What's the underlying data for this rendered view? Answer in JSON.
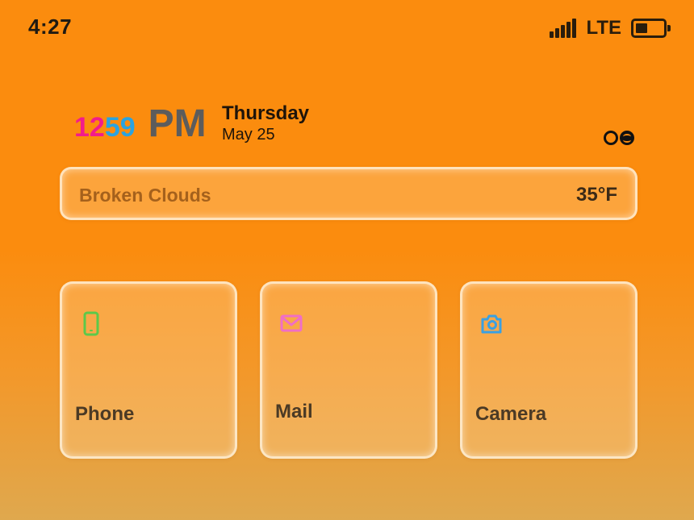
{
  "status_bar": {
    "time": "4:27",
    "network": "LTE",
    "signal_bars": 5,
    "battery_level": 0.45
  },
  "clock": {
    "hour": "12",
    "minute": "59",
    "ampm": "PM",
    "weekday": "Thursday",
    "date": "May 25"
  },
  "weather": {
    "description": "Broken Clouds",
    "temperature": "35°F"
  },
  "apps": [
    {
      "label": "Phone",
      "icon": "phone-icon",
      "icon_color": "#5cc94a"
    },
    {
      "label": "Mail",
      "icon": "mail-icon",
      "icon_color": "#f06ec6"
    },
    {
      "label": "Camera",
      "icon": "camera-icon",
      "icon_color": "#3aa0e2"
    }
  ],
  "colors": {
    "background_top": "#fb8c0e",
    "background_bottom": "#dfa84e",
    "clock_hour": "#f21c8c",
    "clock_minute": "#2aa3e0",
    "clock_ampm": "#5c5c5c",
    "weather_text": "#a5611c"
  }
}
